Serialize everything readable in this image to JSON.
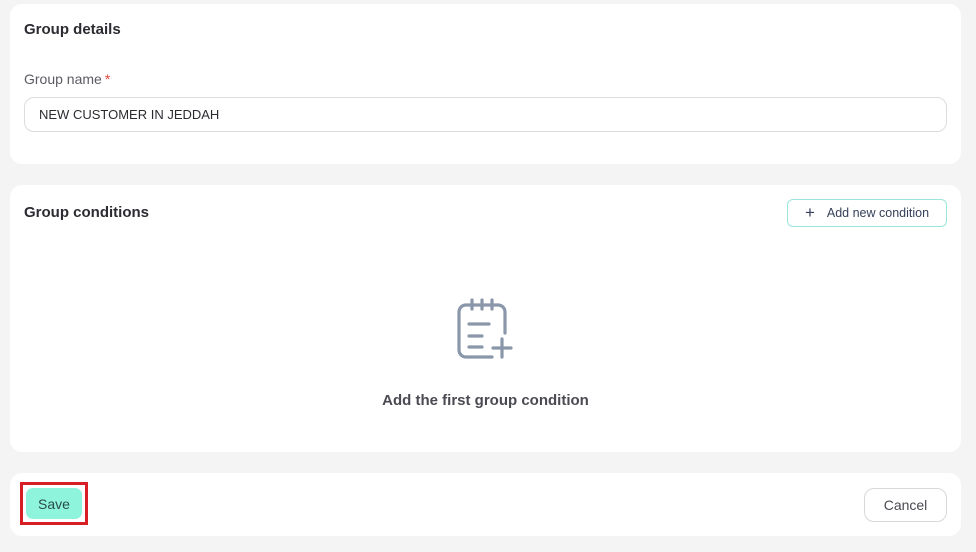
{
  "details": {
    "title": "Group details",
    "group_name_label": "Group name",
    "required_mark": "*",
    "group_name_value": "NEW CUSTOMER IN JEDDAH"
  },
  "conditions": {
    "title": "Group conditions",
    "add_button_label": "Add new condition",
    "add_button_icon": "plus-icon",
    "empty_icon": "notepad-plus-icon",
    "empty_message": "Add the first group condition"
  },
  "footer": {
    "save_label": "Save",
    "cancel_label": "Cancel"
  },
  "colors": {
    "accent": "#8ef5dc",
    "accent_border": "#9be6dc",
    "highlight": "#d81f26",
    "required": "#e0453b",
    "background": "#f4f4f5",
    "icon": "#8a96aa"
  }
}
